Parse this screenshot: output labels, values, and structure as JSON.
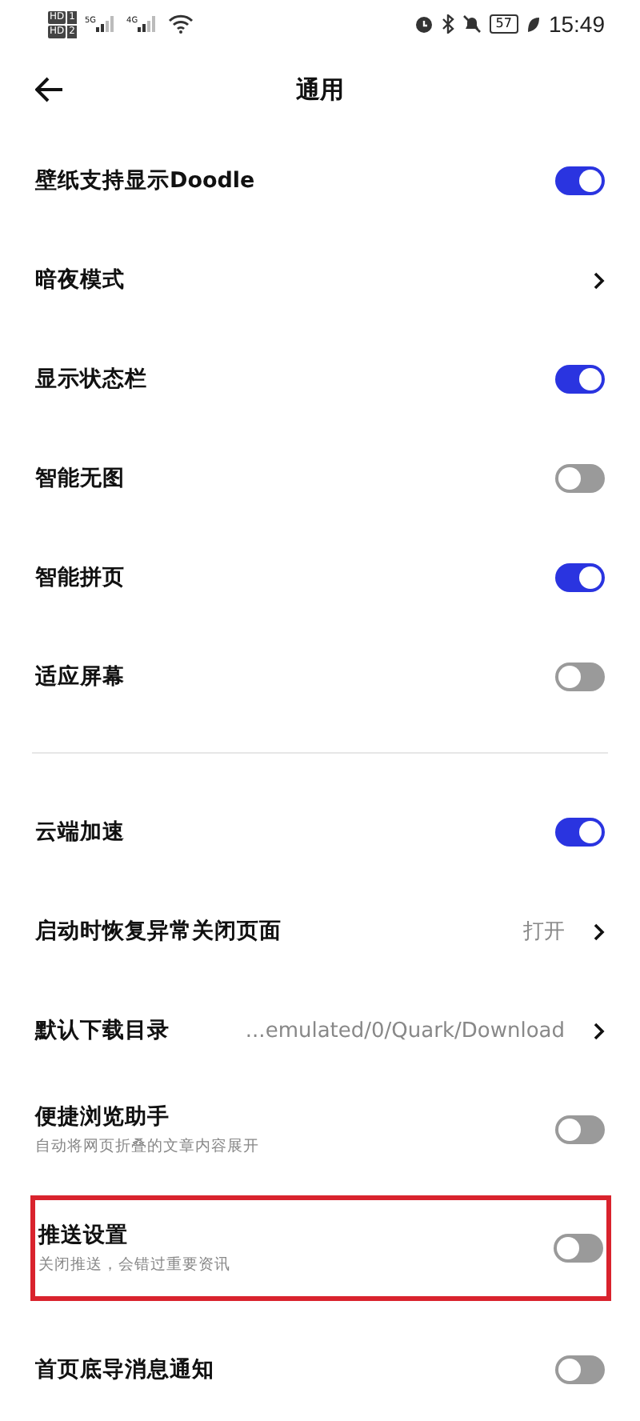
{
  "status_bar": {
    "sims": [
      {
        "badge": "HD",
        "slot": "1"
      },
      {
        "badge": "HD",
        "slot": "2"
      }
    ],
    "networks": [
      "5G",
      "4G"
    ],
    "battery": "57",
    "time": "15:49"
  },
  "header": {
    "title": "通用"
  },
  "groups": [
    {
      "items": [
        {
          "kind": "toggle",
          "label": "壁纸支持显示Doodle",
          "on": true
        },
        {
          "kind": "link",
          "label": "暗夜模式"
        },
        {
          "kind": "toggle",
          "label": "显示状态栏",
          "on": true
        },
        {
          "kind": "toggle",
          "label": "智能无图",
          "on": false
        },
        {
          "kind": "toggle",
          "label": "智能拼页",
          "on": true
        },
        {
          "kind": "toggle",
          "label": "适应屏幕",
          "on": false
        }
      ]
    },
    {
      "items": [
        {
          "kind": "toggle",
          "label": "云端加速",
          "on": true
        },
        {
          "kind": "link",
          "label": "启动时恢复异常关闭页面",
          "value": "打开"
        },
        {
          "kind": "link",
          "label": "默认下载目录",
          "value": "...emulated/0/Quark/Download"
        },
        {
          "kind": "toggle",
          "label": "便捷浏览助手",
          "subtitle": "自动将网页折叠的文章内容展开",
          "on": false
        },
        {
          "kind": "toggle",
          "label": "推送设置",
          "subtitle": "关闭推送，会错过重要资讯",
          "on": false,
          "highlighted": true
        },
        {
          "kind": "toggle",
          "label": "首页底导消息通知",
          "on": false
        }
      ]
    }
  ]
}
